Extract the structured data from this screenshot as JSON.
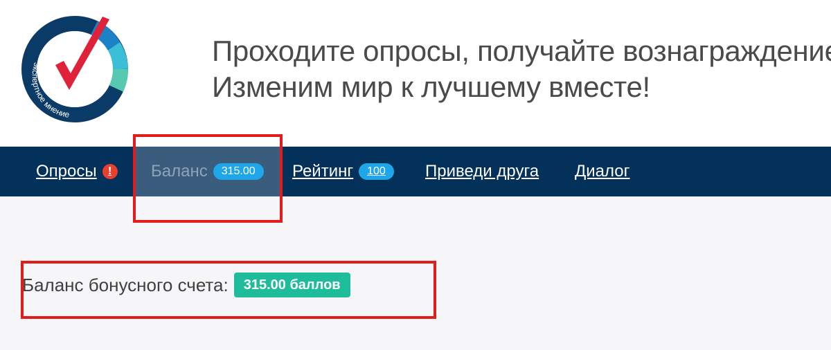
{
  "logo": {
    "icon": "checkmark-circle-logo",
    "ring_text": "экспертное мнение",
    "colors": {
      "ring": "#0a3a66",
      "check": "#e0213a",
      "seg1": "#1c82c8",
      "seg2": "#3bbfd6",
      "seg3": "#56c9b3"
    }
  },
  "tagline": {
    "line1": "Проходите опросы, получайте вознаграждение.",
    "line2": "Изменим мир к лучшему вместе!"
  },
  "nav": {
    "items": [
      {
        "label": "Опросы",
        "badge": "!"
      },
      {
        "label": "Баланс",
        "badge": "315.00"
      },
      {
        "label": "Рейтинг",
        "badge": "100"
      },
      {
        "label": "Приведи друга"
      },
      {
        "label": "Диалог"
      }
    ]
  },
  "balance": {
    "label": "Баланс бонусного счета:",
    "value": "315.00 баллов"
  },
  "colors": {
    "navbar": "#04315a",
    "pill": "#1fa6e8",
    "balance_badge": "#1fbc9c",
    "highlight": "#e21b1b"
  }
}
